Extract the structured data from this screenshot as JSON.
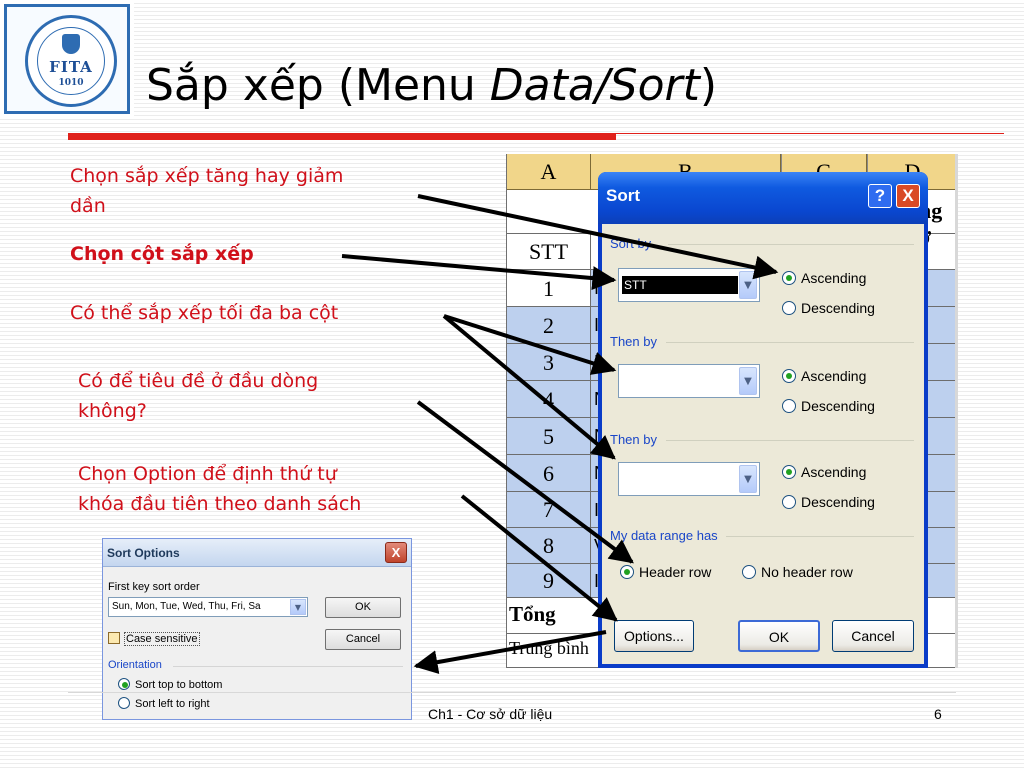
{
  "slide": {
    "title_normal": "Sắp xếp (Menu ",
    "title_italic": "Data/Sort",
    "title_close": ")",
    "footer": "Ch1 - Cơ sở dữ liệu",
    "page_number": "6"
  },
  "logo": {
    "text": "FITA",
    "year": "1010"
  },
  "captions": {
    "sort_order_line1": "Chọn sắp xếp tăng hay giảm",
    "sort_order_line2": "dần",
    "choose_column": "Chọn cột sắp xếp",
    "three_columns": "Có thể sắp xếp tối đa ba cột",
    "header_line1": "Có để tiêu đề ở đầu dòng",
    "header_line2": "không?",
    "option_line1": "Chọn Option để định thứ tự",
    "option_line2": "khóa đầu tiên theo danh sách"
  },
  "spreadsheet": {
    "columns": [
      "A",
      "B",
      "C",
      "D"
    ],
    "header_cell": "STT",
    "rows": [
      "1",
      "2",
      "3",
      "4",
      "5",
      "6",
      "7",
      "8",
      "9"
    ],
    "row_b_initials": [
      "I",
      "I",
      "N",
      "N",
      "N",
      "N",
      "I",
      "V",
      "I"
    ],
    "total_label": "Tổng",
    "average_label": "Trung bình",
    "partial_header": "ng ở"
  },
  "sort_dialog": {
    "title": "Sort",
    "help_label": "?",
    "close_label": "X",
    "sort_by_label": "Sort by",
    "sort_by_value": "STT",
    "then_by_1_label": "Then by",
    "then_by_2_label": "Then by",
    "ascending": "Ascending",
    "descending": "Descending",
    "data_range_label": "My data range has",
    "header_row": "Header row",
    "no_header_row": "No header row",
    "options_button": "Options...",
    "ok_button": "OK",
    "cancel_button": "Cancel"
  },
  "options_dialog": {
    "title": "Sort Options",
    "close_label": "X",
    "first_key_label": "First key sort order",
    "first_key_value": "Sun, Mon, Tue, Wed, Thu, Fri, Sa",
    "case_sensitive": "Case sensitive",
    "orientation_label": "Orientation",
    "top_to_bottom": "Sort top to bottom",
    "left_to_right": "Sort left to right",
    "ok_button": "OK",
    "cancel_button": "Cancel"
  },
  "colors": {
    "accent_red": "#e0211b",
    "caption_red": "#d0101a",
    "column_header": "#f1d68a",
    "selection_blue": "#bdd0ee",
    "xp_title_blue": "#0a47d0"
  }
}
